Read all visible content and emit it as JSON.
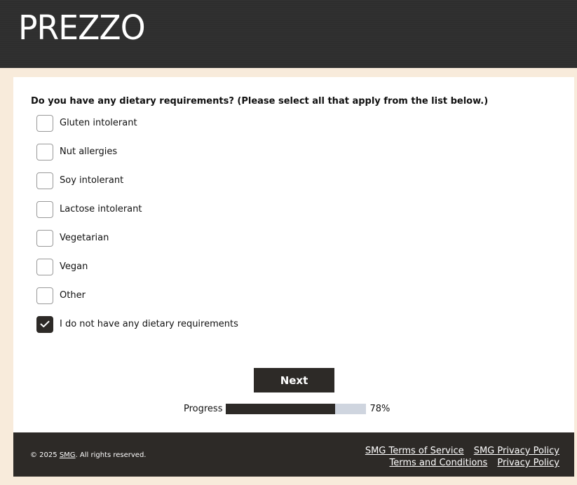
{
  "header": {
    "logo": "PREZZO"
  },
  "survey": {
    "question": "Do you have any dietary requirements? (Please select all that apply from the list below.)",
    "options": [
      {
        "label": "Gluten intolerant",
        "checked": false
      },
      {
        "label": "Nut allergies",
        "checked": false
      },
      {
        "label": "Soy intolerant",
        "checked": false
      },
      {
        "label": "Lactose intolerant",
        "checked": false
      },
      {
        "label": "Vegetarian",
        "checked": false
      },
      {
        "label": "Vegan",
        "checked": false
      },
      {
        "label": "Other",
        "checked": false
      },
      {
        "label": "I do not have any dietary requirements",
        "checked": true
      }
    ],
    "next_label": "Next",
    "progress_label": "Progress",
    "progress_percent": 78,
    "progress_text": "78%"
  },
  "footer": {
    "copyright_prefix": "© 2025 ",
    "copyright_link": "SMG",
    "copyright_suffix": ". All rights reserved.",
    "links_row1": [
      "SMG Terms of Service",
      "SMG Privacy Policy"
    ],
    "links_row2": [
      "Terms and Conditions",
      "Privacy Policy"
    ]
  },
  "colors": {
    "accent": "#2d2a27",
    "page_background": "#f8ebdb",
    "progress_track": "#cfd5df"
  }
}
